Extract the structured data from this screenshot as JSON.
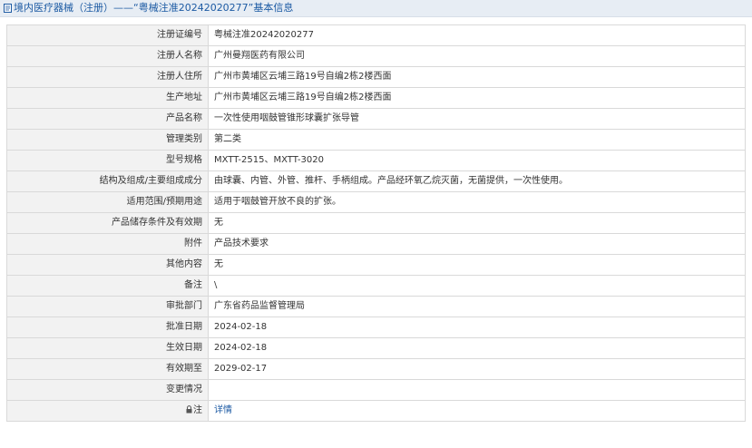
{
  "header": {
    "title": "境内医疗器械（注册）——“粤械注准20242020277”基本信息"
  },
  "rows": [
    {
      "label": "注册证编号",
      "value": "粤械注准20242020277"
    },
    {
      "label": "注册人名称",
      "value": "广州曼翔医药有限公司"
    },
    {
      "label": "注册人住所",
      "value": "广州市黄埔区云埔三路19号自编2栋2楼西面"
    },
    {
      "label": "生产地址",
      "value": "广州市黄埔区云埔三路19号自编2栋2楼西面"
    },
    {
      "label": "产品名称",
      "value": "一次性使用咽鼓管锥形球囊扩张导管"
    },
    {
      "label": "管理类别",
      "value": "第二类"
    },
    {
      "label": "型号规格",
      "value": "MXTT-2515、MXTT-3020"
    },
    {
      "label": "结构及组成/主要组成成分",
      "value": "由球囊、内管、外管、推杆、手柄组成。产品经环氧乙烷灭菌，无菌提供，一次性使用。"
    },
    {
      "label": "适用范围/预期用途",
      "value": "适用于咽鼓管开放不良的扩张。"
    },
    {
      "label": "产品储存条件及有效期",
      "value": "无"
    },
    {
      "label": "附件",
      "value": "产品技术要求"
    },
    {
      "label": "其他内容",
      "value": "无"
    },
    {
      "label": "备注",
      "value": "\\"
    },
    {
      "label": "审批部门",
      "value": "广东省药品监督管理局"
    },
    {
      "label": "批准日期",
      "value": "2024-02-18"
    },
    {
      "label": "生效日期",
      "value": "2024-02-18"
    },
    {
      "label": "有效期至",
      "value": "2029-02-17"
    },
    {
      "label": "变更情况",
      "value": ""
    }
  ],
  "note_row": {
    "icon": "lock-icon",
    "label": "注",
    "link_text": "详情"
  },
  "colors": {
    "header_bg": "#e7edf4",
    "title_blue": "#1c5aa3",
    "label_bg": "#f2f2f2",
    "border": "#d9d9d9"
  }
}
